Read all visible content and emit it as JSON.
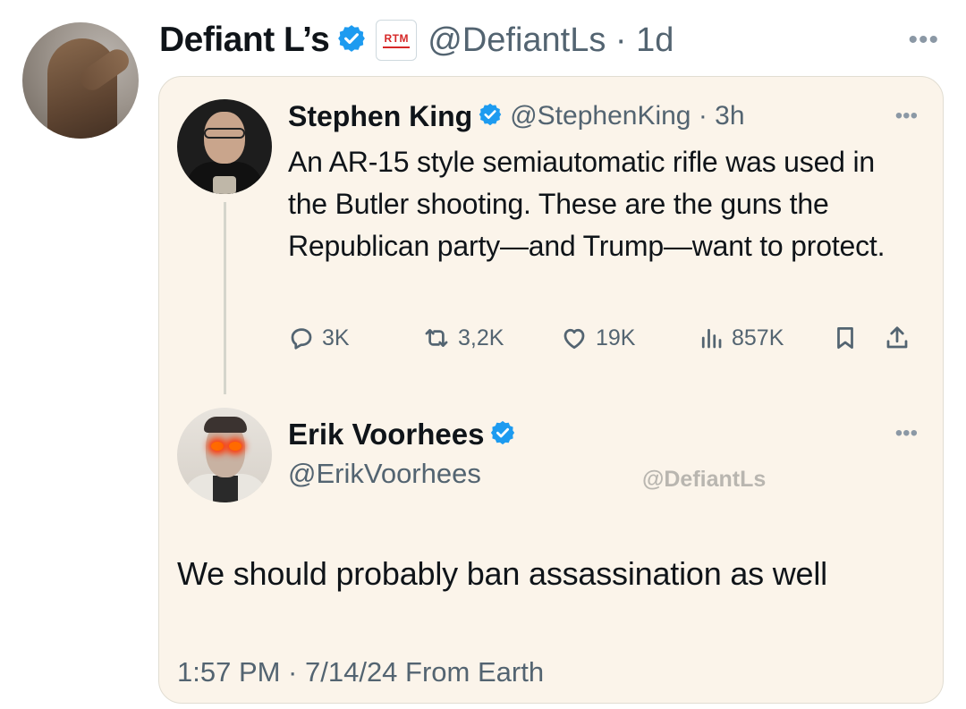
{
  "tweet": {
    "author_name": "Defiant L’s",
    "org_badge": "RTM",
    "handle_time": "@DefiantLs · 1d",
    "more": "•••"
  },
  "quoted": {
    "author_name": "Stephen King",
    "handle_time": "@StephenKing · 3h",
    "more": "•••",
    "text": "An AR-15 style semiautomatic rifle was used in the Butler shooting. These are the guns the Republican party—and Trump—want to protect.",
    "actions": {
      "replies": "3K",
      "reposts": "3,2K",
      "likes": "19K",
      "views": "857K"
    }
  },
  "reply": {
    "author_name": "Erik Voorhees",
    "handle": "@ErikVoorhees",
    "more": "•••",
    "watermark": "@DefiantLs",
    "text": "We should probably ban assassination as well",
    "timestamp": "1:57 PM · 7/14/24 From Earth"
  },
  "colors": {
    "verified_blue": "#1d9bf0",
    "card_background": "#fbf4ea",
    "secondary_text": "#536471"
  },
  "icons": [
    "reply-icon",
    "repost-icon",
    "like-icon",
    "views-icon",
    "bookmark-icon",
    "share-icon",
    "verified-badge-icon"
  ]
}
